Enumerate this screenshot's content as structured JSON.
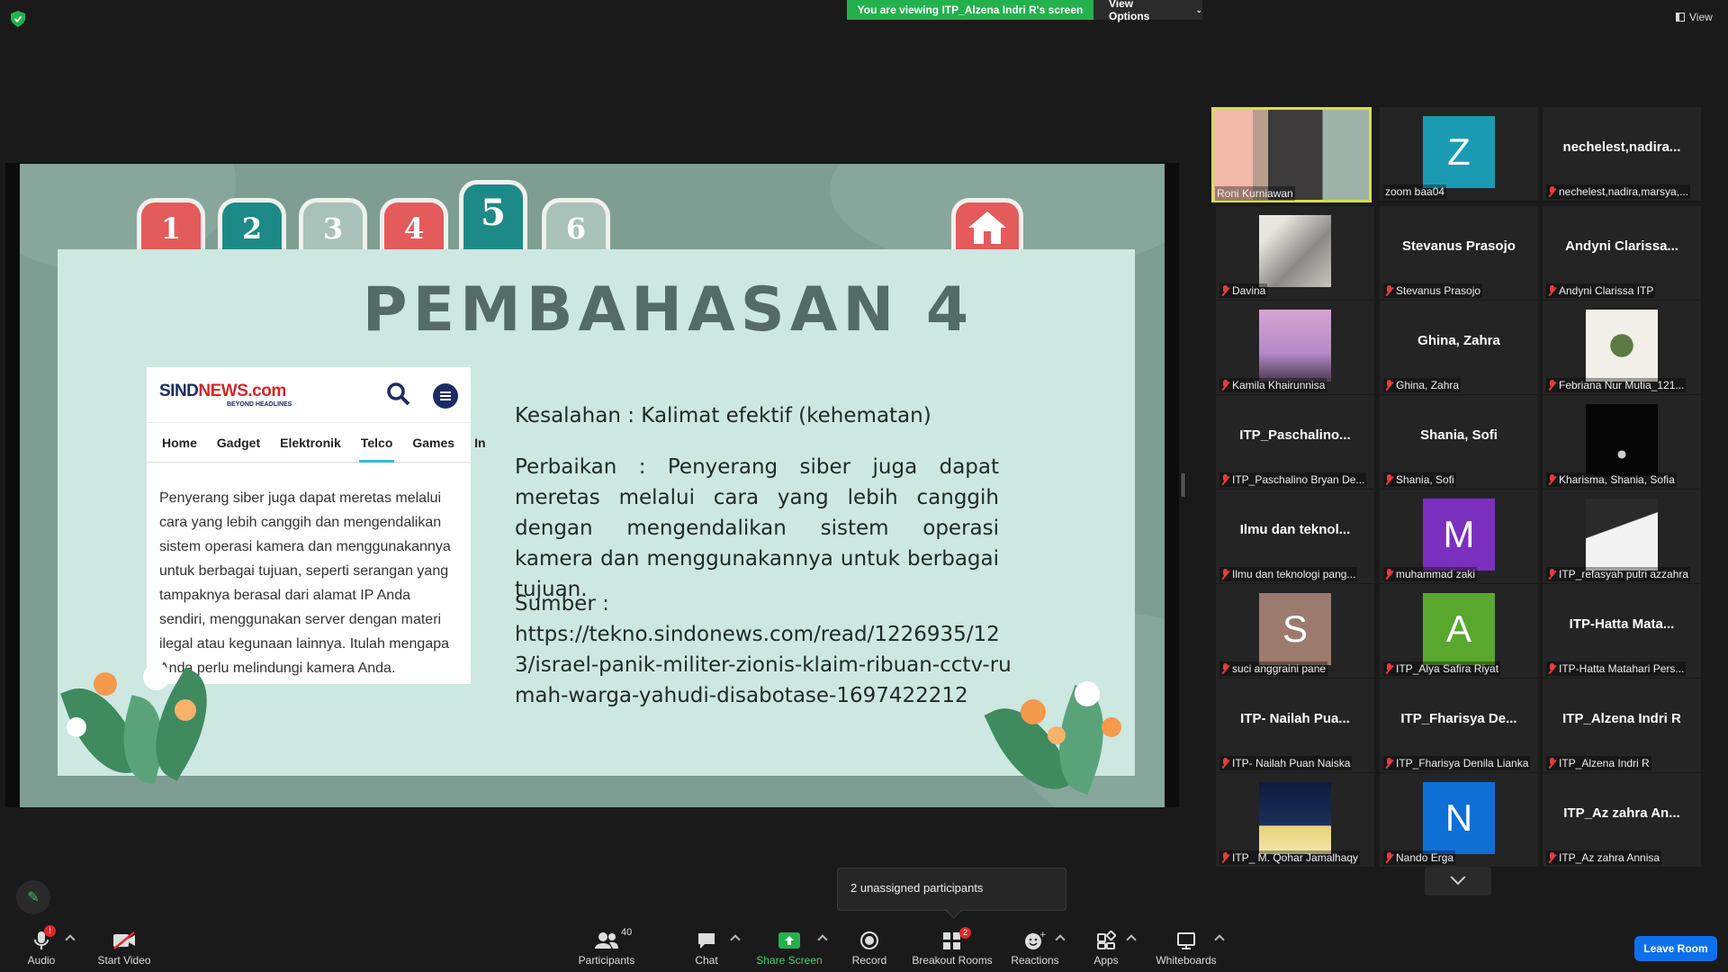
{
  "topbar": {
    "viewing_text": "You are viewing ITP_Alzena Indri R's screen",
    "view_options": "View Options",
    "view_label": "View"
  },
  "slide": {
    "tabs": [
      "1",
      "2",
      "3",
      "4",
      "5",
      "6"
    ],
    "title": "PEMBAHASAN 4",
    "news": {
      "logo_a": "SIND",
      "logo_b": "NEWS.com",
      "tagline": "BEYOND HEADLINES",
      "nav": [
        "Home",
        "Gadget",
        "Elektronik",
        "Telco",
        "Games",
        "In"
      ],
      "body": "Penyerang siber juga dapat meretas melalui cara yang lebih canggih dan mengendalikan sistem operasi kamera dan menggunakannya untuk berbagai tujuan, seperti serangan yang tampaknya berasal dari alamat IP Anda sendiri, menggunakan server dengan materi ilegal atau kegunaan lainnya. Itulah mengapa Anda perlu melindungi kamera Anda."
    },
    "kesalahan": "Kesalahan : Kalimat efektif (kehematan)",
    "perbaikan": "Perbaikan : Penyerang siber juga dapat meretas melalui cara yang lebih canggih dengan mengendalikan sistem operasi kamera dan menggunakannya untuk berbagai tujuan.",
    "sumber_label": "Sumber :",
    "sumber_url": "https://tekno.sindonews.com/read/1226935/123/israel-panik-militer-zionis-klaim-ribuan-cctv-rumah-warga-yahudi-disabotase-1697422212"
  },
  "gallery": [
    {
      "name": "",
      "label": "Roni Kurniawan",
      "type": "video",
      "muted": false
    },
    {
      "name": "",
      "label": "zoom baa04",
      "type": "avatar",
      "letter": "Z",
      "color": "#1a9bb1",
      "muted": false
    },
    {
      "name": "nechelest,nadira...",
      "label": "nechelest,nadira,marsya,...",
      "type": "text",
      "muted": true
    },
    {
      "name": "",
      "label": "Davina",
      "type": "photo",
      "muted": true
    },
    {
      "name": "Stevanus Prasojo",
      "label": "Stevanus Prasojo",
      "type": "text",
      "muted": true
    },
    {
      "name": "Andyni Clarissa...",
      "label": "Andyni Clarissa ITP",
      "type": "text",
      "muted": true
    },
    {
      "name": "",
      "label": "Kamila Khairunnisa",
      "type": "photo",
      "muted": true
    },
    {
      "name": "Ghina, Zahra",
      "label": "Ghina, Zahra",
      "type": "text",
      "muted": true
    },
    {
      "name": "",
      "label": "Febriana Nur Mutia_121...",
      "type": "photo",
      "muted": true
    },
    {
      "name": "ITP_Paschalino...",
      "label": "ITP_Paschalino Bryan De...",
      "type": "text",
      "muted": true
    },
    {
      "name": "Shania, Sofi",
      "label": "Shania, Sofi",
      "type": "text",
      "muted": true
    },
    {
      "name": "",
      "label": "Kharisma, Shania, Sofia",
      "type": "photo",
      "muted": true
    },
    {
      "name": "Ilmu dan teknol...",
      "label": "Ilmu dan teknologi pang...",
      "type": "text",
      "muted": true
    },
    {
      "name": "",
      "label": "muhammad zaki",
      "type": "avatar",
      "letter": "M",
      "color": "#7b2fbf",
      "muted": true
    },
    {
      "name": "",
      "label": "ITP_refasyah putri azzahra",
      "type": "photo",
      "muted": true
    },
    {
      "name": "",
      "label": "suci anggraini pane",
      "type": "avatar",
      "letter": "S",
      "color": "#9c7a6e",
      "muted": true
    },
    {
      "name": "",
      "label": "ITP_Alya Safira Riyat",
      "type": "avatar",
      "letter": "A",
      "color": "#5aa72e",
      "muted": true
    },
    {
      "name": "ITP-Hatta Mata...",
      "label": "ITP-Hatta Matahari Pers...",
      "type": "text",
      "muted": true
    },
    {
      "name": "ITP- Nailah Pua...",
      "label": "ITP- Nailah Puan Naiska",
      "type": "text",
      "muted": true
    },
    {
      "name": "ITP_Fharisya De...",
      "label": "ITP_Fharisya Denila Lianka",
      "type": "text",
      "muted": true
    },
    {
      "name": "ITP_Alzena Indri R",
      "label": "ITP_Alzena Indri R",
      "type": "text",
      "muted": true
    },
    {
      "name": "",
      "label": "ITP_ M. Qohar Jamalhaqy",
      "type": "photo",
      "muted": true
    },
    {
      "name": "",
      "label": "Nando Erga",
      "type": "avatar",
      "letter": "N",
      "color": "#0e6fd6",
      "muted": true
    },
    {
      "name": "ITP_Az zahra An...",
      "label": "ITP_Az zahra Annisa",
      "type": "text",
      "muted": true
    }
  ],
  "unassigned": "2 unassigned participants",
  "toolbar": {
    "audio": "Audio",
    "audio_badge": "!",
    "video": "Start Video",
    "participants": "Participants",
    "participants_count": "40",
    "chat": "Chat",
    "share": "Share Screen",
    "record": "Record",
    "breakout": "Breakout Rooms",
    "breakout_badge": "2",
    "reactions": "Reactions",
    "apps": "Apps",
    "whiteboards": "Whiteboards",
    "leave": "Leave Room"
  }
}
